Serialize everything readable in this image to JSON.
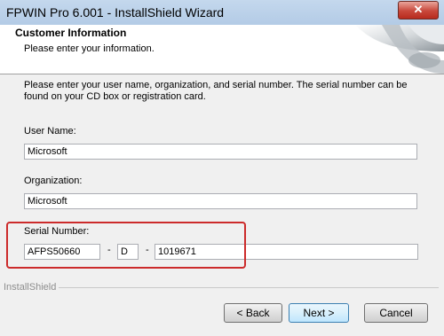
{
  "window": {
    "title": "FPWIN Pro 6.001 - InstallShield Wizard",
    "close_label": "✕"
  },
  "header": {
    "title": "Customer Information",
    "subtitle": "Please enter your information."
  },
  "description": "Please enter your user name, organization, and serial number. The serial number can be found on your CD box or registration card.",
  "fields": {
    "user_name": {
      "label": "User Name:",
      "value": "Microsoft"
    },
    "organization": {
      "label": "Organization:",
      "value": "Microsoft"
    },
    "serial": {
      "label": "Serial Number:",
      "part1": "AFPS50660",
      "part2": "D",
      "part3": "1019671",
      "separator": "-"
    }
  },
  "footer": {
    "brand": "InstallShield"
  },
  "buttons": {
    "back": "< Back",
    "next": "Next >",
    "cancel": "Cancel"
  },
  "colors": {
    "highlight": "#cc2b2b",
    "title_bar": "#c4d8ed"
  }
}
